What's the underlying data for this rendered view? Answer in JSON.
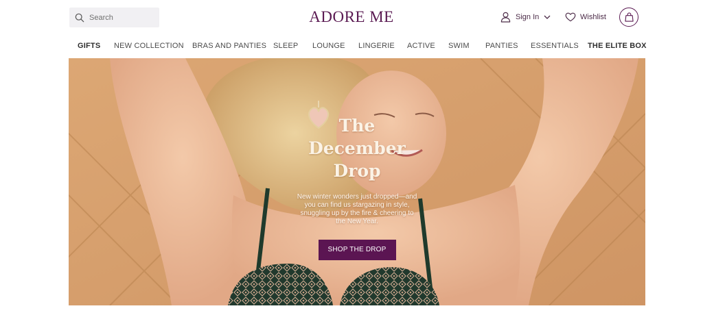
{
  "header": {
    "search_placeholder": "Search",
    "logo": "ADORE ME",
    "sign_in_label": "Sign In",
    "wishlist_label": "Wishlist",
    "brand_color": "#5a1a52"
  },
  "nav": {
    "items": [
      {
        "label": "GIFTS",
        "bold": true
      },
      {
        "label": "NEW COLLECTION",
        "bold": false
      },
      {
        "label": "BRAS AND PANTIES",
        "bold": false
      },
      {
        "label": "SLEEP",
        "bold": false
      },
      {
        "label": "LOUNGE",
        "bold": false
      },
      {
        "label": "LINGERIE",
        "bold": false
      },
      {
        "label": "ACTIVE",
        "bold": false
      },
      {
        "label": "SWIM",
        "bold": false
      },
      {
        "label": "PANTIES",
        "bold": false
      },
      {
        "label": "ESSENTIALS",
        "bold": false
      },
      {
        "label": "THE ELITE BOX",
        "bold": true
      }
    ]
  },
  "hero": {
    "title": "The\nDecember\nDrop",
    "description": "New winter wonders just dropped—and you can find us stargazing in style, snuggling up by the fire & cheering to the New Year.",
    "cta_label": "SHOP THE DROP",
    "cta_color": "#5b1552"
  }
}
